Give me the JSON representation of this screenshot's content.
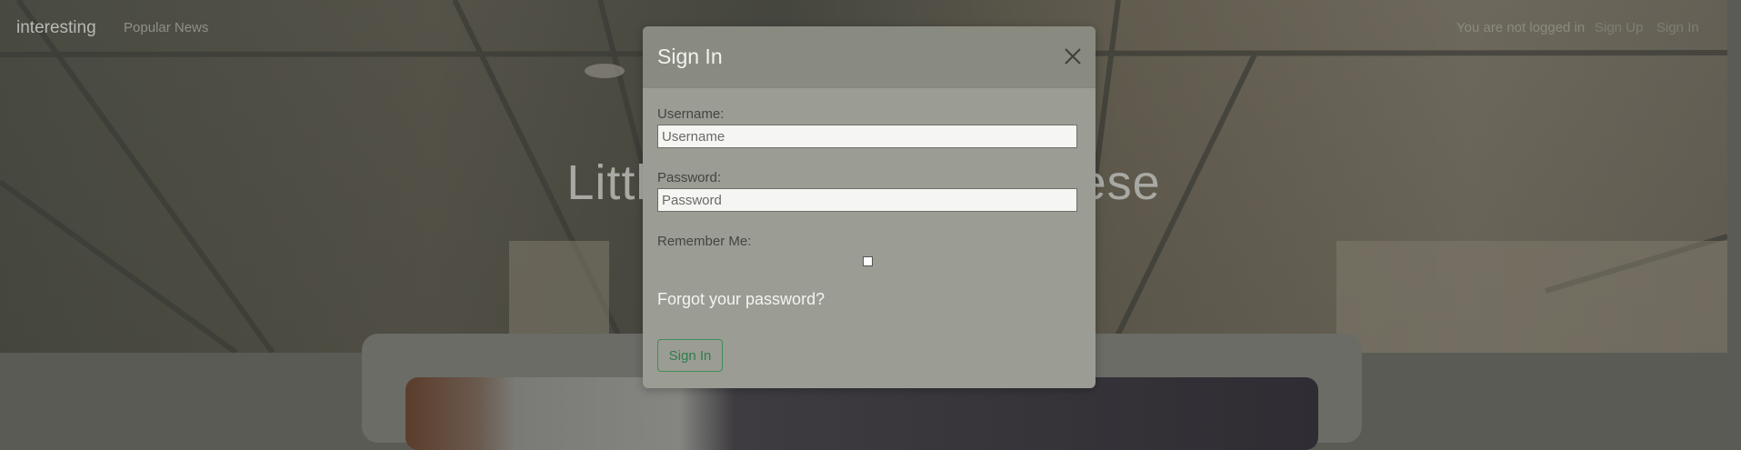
{
  "navbar": {
    "brand": "interesting",
    "popular_link": "Popular News",
    "login_status": "You are not logged in",
    "signup_link": "Sign Up",
    "signin_link": "Sign In"
  },
  "hero": {
    "title": "Little horse … e of cheese"
  },
  "modal": {
    "title": "Sign In",
    "close_icon": "close-icon",
    "username_label": "Username:",
    "username_placeholder": "Username",
    "username_value": "",
    "password_label": "Password:",
    "password_placeholder": "Password",
    "password_value": "",
    "remember_label": "Remember Me:",
    "remember_checked": false,
    "forgot_link": "Forgot your password?",
    "submit_label": "Sign In"
  },
  "colors": {
    "overlay": "#5a5b55",
    "modal_bg": "#9b9c93",
    "modal_header": "#8a8b80",
    "accent_green": "#2f7e4c"
  }
}
